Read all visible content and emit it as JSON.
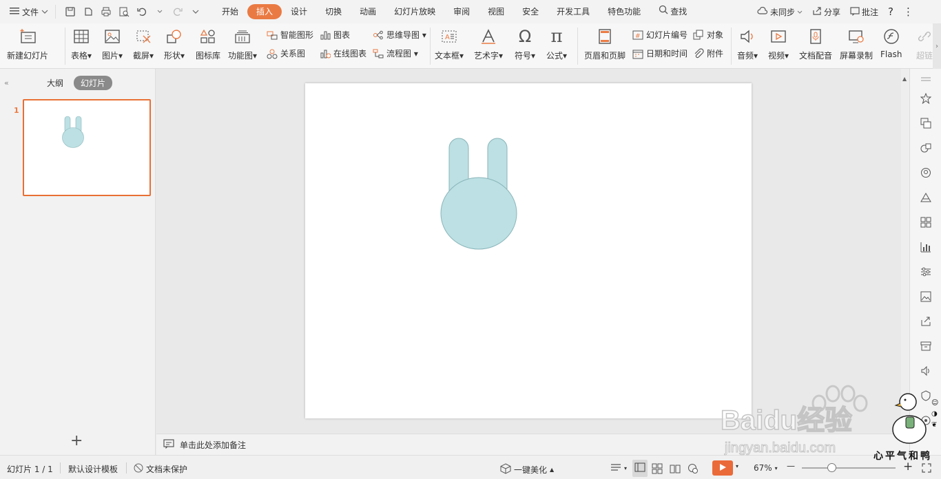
{
  "menu": {
    "file": "文件",
    "tabs": [
      "开始",
      "插入",
      "设计",
      "切换",
      "动画",
      "幻灯片放映",
      "审阅",
      "视图",
      "安全",
      "开发工具",
      "特色功能"
    ],
    "active_tab": "插入",
    "search": "查找",
    "sync": "未同步",
    "share": "分享",
    "comment": "批注",
    "help": "?",
    "more": "⋮"
  },
  "ribbon": {
    "new_slide": "新建幻灯片",
    "table": "表格",
    "picture": "图片",
    "screenshot": "截屏",
    "shape": "形状",
    "icon_library": "图标库",
    "function_chart": "功能图",
    "smart_art": "智能图形",
    "chart": "图表",
    "relation": "关系图",
    "online_chart": "在线图表",
    "mind_map": "思维导图",
    "flowchart": "流程图",
    "textbox": "文本框",
    "art_text": "艺术字",
    "symbol": "符号",
    "formula": "公式",
    "header_footer": "页眉和页脚",
    "slide_number": "幻灯片编号",
    "object": "对象",
    "date_time": "日期和时间",
    "attachment": "附件",
    "audio": "音频",
    "video": "视频",
    "doc_dubbing": "文档配音",
    "screen_record": "屏幕录制",
    "flash": "Flash",
    "hyperlink": "超链"
  },
  "left_panel": {
    "outline_tab": "大纲",
    "slides_tab": "幻灯片",
    "slide_number": "1",
    "add": "+"
  },
  "notes": {
    "placeholder": "单击此处添加备注"
  },
  "status": {
    "slide_count": "幻灯片 1 / 1",
    "template": "默认设计模板",
    "protection": "文档未保护",
    "beautify": "一键美化",
    "zoom": "67%",
    "minus": "—",
    "plus": "+"
  },
  "watermark": {
    "brand": "Baidu经验",
    "url": "jingyan.baidu.com",
    "slogan": "心平气和鸭"
  },
  "colors": {
    "accent": "#ea7a43",
    "shape_fill": "#bce0e3",
    "shape_stroke": "#8ab5ba",
    "thumb_border": "#e86f34"
  }
}
